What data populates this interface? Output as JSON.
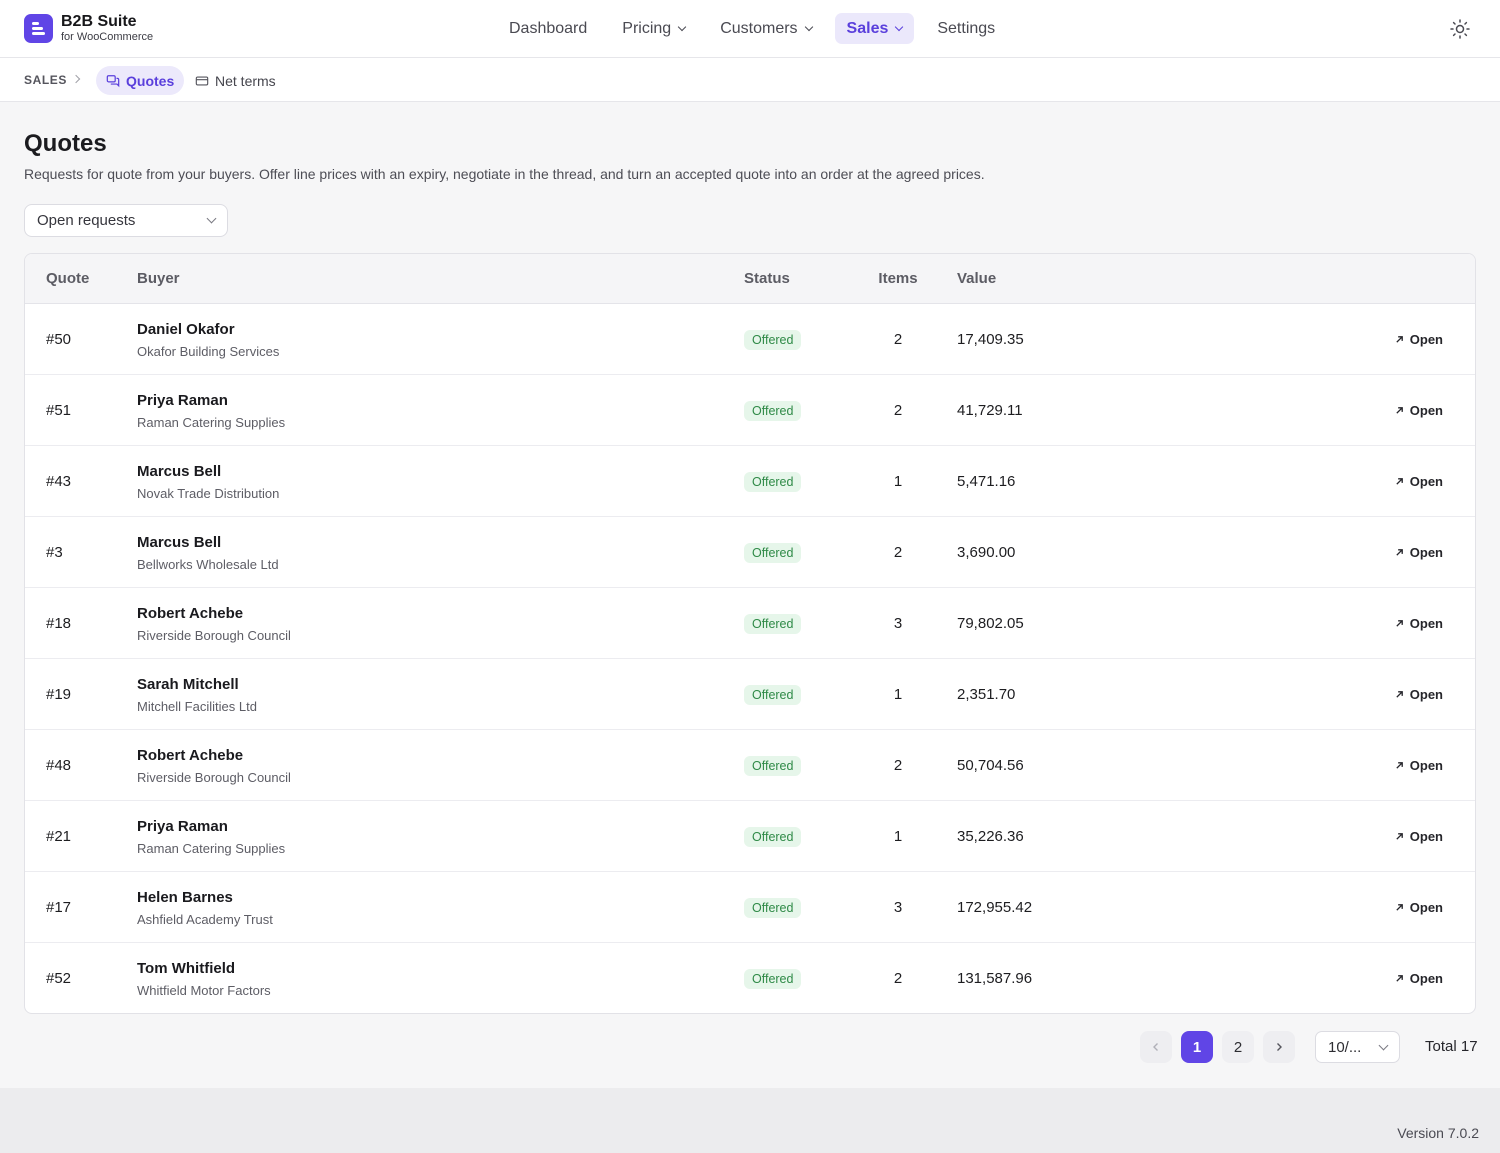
{
  "app": {
    "title": "B2B Suite",
    "subtitle": "for WooCommerce"
  },
  "nav": {
    "items": [
      {
        "label": "Dashboard"
      },
      {
        "label": "Pricing"
      },
      {
        "label": "Customers"
      },
      {
        "label": "Sales"
      },
      {
        "label": "Settings"
      }
    ],
    "active": "Sales",
    "theme_icon": "sun-icon"
  },
  "breadcrumb": {
    "root": "SALES",
    "tabs": [
      {
        "label": "Quotes",
        "icon": "chat-icon"
      },
      {
        "label": "Net terms",
        "icon": "card-icon"
      }
    ]
  },
  "page": {
    "title": "Quotes",
    "description": "Requests for quote from your buyers. Offer line prices with an expiry, negotiate in the thread, and turn an accepted quote into an order at the agreed prices.",
    "filter": "Open requests"
  },
  "table": {
    "columns": {
      "quote": "Quote",
      "buyer": "Buyer",
      "status": "Status",
      "items": "Items",
      "value": "Value"
    },
    "open_label": "Open",
    "rows": [
      {
        "quote": "#50",
        "name": "Daniel Okafor",
        "company": "Okafor Building Services",
        "status": "Offered",
        "items": "2",
        "value": "17,409.35"
      },
      {
        "quote": "#51",
        "name": "Priya Raman",
        "company": "Raman Catering Supplies",
        "status": "Offered",
        "items": "2",
        "value": "41,729.11"
      },
      {
        "quote": "#43",
        "name": "Marcus Bell",
        "company": "Novak Trade Distribution",
        "status": "Offered",
        "items": "1",
        "value": "5,471.16"
      },
      {
        "quote": "#3",
        "name": "Marcus Bell",
        "company": "Bellworks Wholesale Ltd",
        "status": "Offered",
        "items": "2",
        "value": "3,690.00"
      },
      {
        "quote": "#18",
        "name": "Robert Achebe",
        "company": "Riverside Borough Council",
        "status": "Offered",
        "items": "3",
        "value": "79,802.05"
      },
      {
        "quote": "#19",
        "name": "Sarah Mitchell",
        "company": "Mitchell Facilities Ltd",
        "status": "Offered",
        "items": "1",
        "value": "2,351.70"
      },
      {
        "quote": "#48",
        "name": "Robert Achebe",
        "company": "Riverside Borough Council",
        "status": "Offered",
        "items": "2",
        "value": "50,704.56"
      },
      {
        "quote": "#21",
        "name": "Priya Raman",
        "company": "Raman Catering Supplies",
        "status": "Offered",
        "items": "1",
        "value": "35,226.36"
      },
      {
        "quote": "#17",
        "name": "Helen Barnes",
        "company": "Ashfield Academy Trust",
        "status": "Offered",
        "items": "3",
        "value": "172,955.42"
      },
      {
        "quote": "#52",
        "name": "Tom Whitfield",
        "company": "Whitfield Motor Factors",
        "status": "Offered",
        "items": "2",
        "value": "131,587.96"
      }
    ]
  },
  "pagination": {
    "pages": [
      "1",
      "2"
    ],
    "current": "1",
    "per_page": "10/...",
    "total": "Total 17"
  },
  "footer": {
    "version": "Version 7.0.2"
  },
  "colors": {
    "accent": "#6045e6",
    "status_offered_bg": "#e6f6ea",
    "status_offered_text": "#2f8a47"
  }
}
